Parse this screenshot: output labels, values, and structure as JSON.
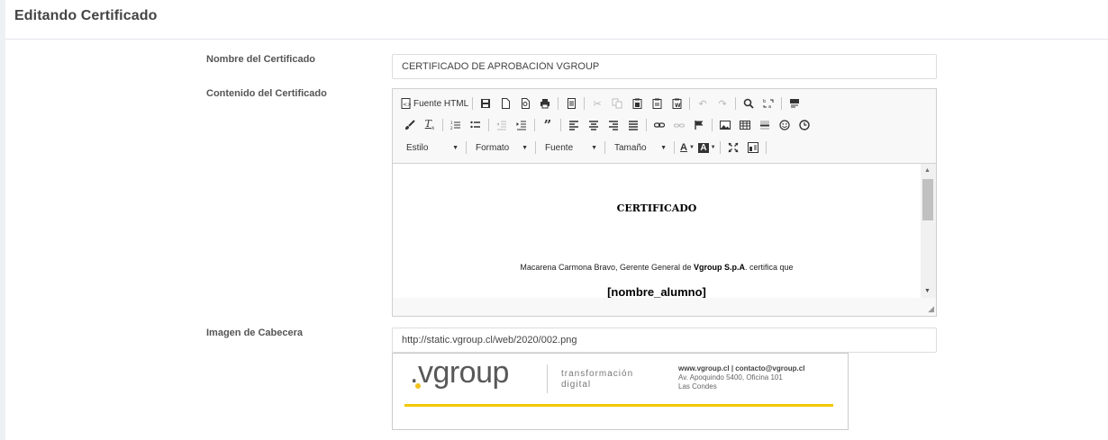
{
  "header": {
    "title": "Editando Certificado"
  },
  "form": {
    "name_label": "Nombre del Certificado",
    "name_value": "CERTIFICADO DE APROBACIÓN VGROUP",
    "content_label": "Contenido del Certificado",
    "image_label": "Imagen de Cabecera",
    "image_value": "http://static.vgroup.cl/web/2020/002.png"
  },
  "editor": {
    "source_label": "Fuente HTML",
    "combos": {
      "style": "Estilo",
      "format": "Formato",
      "font": "Fuente",
      "size": "Tamaño"
    },
    "content": {
      "title": "CERTIFICADO",
      "line_prefix": "Macarena Carmona Bravo, Gerente General de ",
      "line_company": "Vgroup S.p.A",
      "line_suffix": ". certifica que",
      "name_placeholder": "[nombre_alumno]"
    }
  },
  "header_image": {
    "brand": "vgroup",
    "tagline_1": "transformación",
    "tagline_2": "digital",
    "contact_line_1": "www.vgroup.cl | contacto@vgroup.cl",
    "contact_line_2": "Av. Apoquindo 5400, Oficina 101",
    "contact_line_3": "Las Condes"
  },
  "colors": {
    "accent_yellow": "#f2c900",
    "title_color": "#444444"
  }
}
